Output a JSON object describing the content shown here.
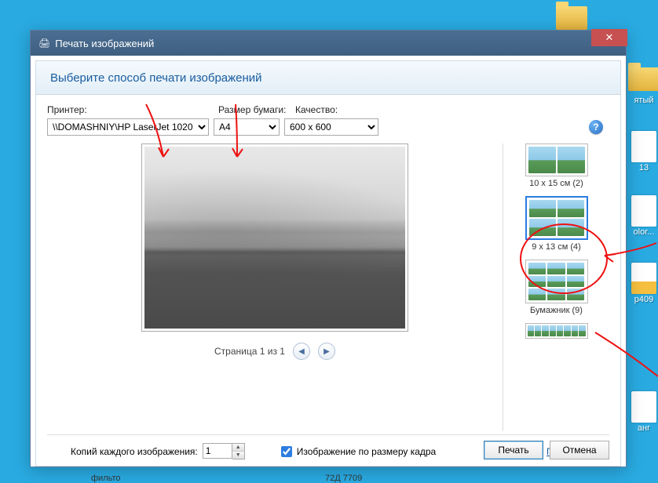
{
  "window": {
    "title": "Печать изображений",
    "subheader": "Выберите способ печати изображений"
  },
  "labels": {
    "printer": "Принтер:",
    "paper": "Размер бумаги:",
    "quality": "Качество:",
    "copies": "Копий каждого изображения:",
    "fit": "Изображение по размеру кадра",
    "params": "Параметры..."
  },
  "selects": {
    "printer": "\\\\DOMASHNIY\\HP LaserJet 1020",
    "paper": "A4",
    "quality": "600 x 600"
  },
  "copies_value": "1",
  "fit_checked": true,
  "pager": {
    "text": "Страница 1 из 1"
  },
  "layouts": [
    {
      "label": "10 x 15 см (2)",
      "grid": "p2"
    },
    {
      "label": "9 x 13 см (4)",
      "grid": "p4",
      "selected": true
    },
    {
      "label": "Бумажник (9)",
      "grid": "p9"
    },
    {
      "label": "",
      "grid": "pstrip"
    }
  ],
  "buttons": {
    "print": "Печать",
    "cancel": "Отмена"
  },
  "desktop": {
    "i1": "ятый",
    "i2": "13",
    "i3": "olor...",
    "i4": "p409",
    "i5": "анг"
  },
  "stray": {
    "a": "фильто",
    "b": "72Д 7709"
  }
}
